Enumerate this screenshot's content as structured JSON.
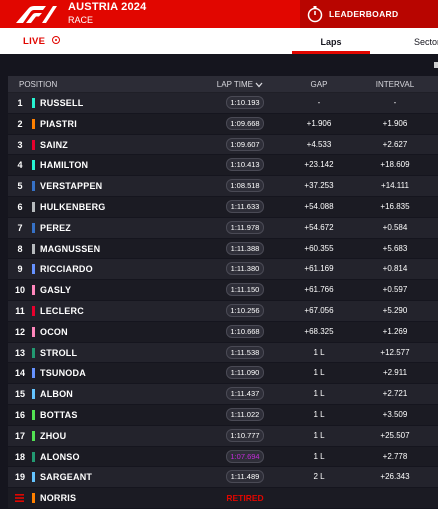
{
  "event": {
    "title": "AUSTRIA 2024",
    "session": "RACE"
  },
  "header": {
    "leaderboard_label": "LEADERBOARD"
  },
  "subbar": {
    "live_label": "LIVE",
    "tabs": [
      "Laps",
      "Sectors"
    ]
  },
  "table": {
    "headers": {
      "position": "POSITION",
      "lap_time": "LAP TIME",
      "gap": "GAP",
      "interval": "INTERVAL"
    },
    "rows": [
      {
        "pos": "1",
        "name": "RUSSELL",
        "team_color": "#27f4d2",
        "lap": "1:10.193",
        "gap": "-",
        "interval": "-"
      },
      {
        "pos": "2",
        "name": "PIASTRI",
        "team_color": "#ff8000",
        "lap": "1:09.668",
        "gap": "+1.906",
        "interval": "+1.906"
      },
      {
        "pos": "3",
        "name": "SAINZ",
        "team_color": "#e8002d",
        "lap": "1:09.607",
        "gap": "+4.533",
        "interval": "+2.627"
      },
      {
        "pos": "4",
        "name": "HAMILTON",
        "team_color": "#27f4d2",
        "lap": "1:10.413",
        "gap": "+23.142",
        "interval": "+18.609"
      },
      {
        "pos": "5",
        "name": "VERSTAPPEN",
        "team_color": "#3671c6",
        "lap": "1:08.518",
        "gap": "+37.253",
        "interval": "+14.111"
      },
      {
        "pos": "6",
        "name": "HULKENBERG",
        "team_color": "#b6babd",
        "lap": "1:11.633",
        "gap": "+54.088",
        "interval": "+16.835"
      },
      {
        "pos": "7",
        "name": "PEREZ",
        "team_color": "#3671c6",
        "lap": "1:11.978",
        "gap": "+54.672",
        "interval": "+0.584"
      },
      {
        "pos": "8",
        "name": "MAGNUSSEN",
        "team_color": "#b6babd",
        "lap": "1:11.388",
        "gap": "+60.355",
        "interval": "+5.683"
      },
      {
        "pos": "9",
        "name": "RICCIARDO",
        "team_color": "#6692ff",
        "lap": "1:11.380",
        "gap": "+61.169",
        "interval": "+0.814"
      },
      {
        "pos": "10",
        "name": "GASLY",
        "team_color": "#ff87bc",
        "lap": "1:11.150",
        "gap": "+61.766",
        "interval": "+0.597"
      },
      {
        "pos": "11",
        "name": "LECLERC",
        "team_color": "#e8002d",
        "lap": "1:10.256",
        "gap": "+67.056",
        "interval": "+5.290"
      },
      {
        "pos": "12",
        "name": "OCON",
        "team_color": "#ff87bc",
        "lap": "1:10.668",
        "gap": "+68.325",
        "interval": "+1.269"
      },
      {
        "pos": "13",
        "name": "STROLL",
        "team_color": "#229971",
        "lap": "1:11.538",
        "gap": "1 L",
        "interval": "+12.577"
      },
      {
        "pos": "14",
        "name": "TSUNODA",
        "team_color": "#6692ff",
        "lap": "1:11.090",
        "gap": "1 L",
        "interval": "+2.911"
      },
      {
        "pos": "15",
        "name": "ALBON",
        "team_color": "#64c4ff",
        "lap": "1:11.437",
        "gap": "1 L",
        "interval": "+2.721"
      },
      {
        "pos": "16",
        "name": "BOTTAS",
        "team_color": "#52e252",
        "lap": "1:11.022",
        "gap": "1 L",
        "interval": "+3.509"
      },
      {
        "pos": "17",
        "name": "ZHOU",
        "team_color": "#52e252",
        "lap": "1:10.777",
        "gap": "1 L",
        "interval": "+25.507"
      },
      {
        "pos": "18",
        "name": "ALONSO",
        "team_color": "#229971",
        "lap": "1:07.694",
        "gap": "1 L",
        "interval": "+2.778",
        "fastest": true
      },
      {
        "pos": "19",
        "name": "SARGEANT",
        "team_color": "#64c4ff",
        "lap": "1:11.489",
        "gap": "2 L",
        "interval": "+26.343"
      }
    ],
    "retired": {
      "name": "NORRIS",
      "team_color": "#ff8000",
      "status": "RETIRED"
    }
  },
  "colors": {
    "f1_red": "#e10600",
    "fastest_lap": "#c22cd8"
  }
}
